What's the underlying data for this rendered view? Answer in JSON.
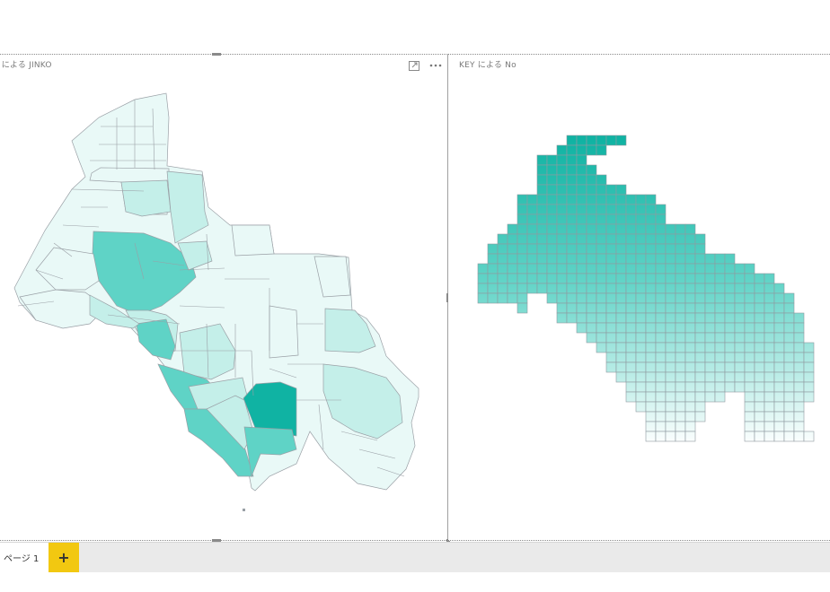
{
  "visuals": {
    "left": {
      "title": "' による JINKO",
      "focus_mode_icon": "focus-mode-icon",
      "more_options_icon": "more-options-icon"
    },
    "right": {
      "title": "KEY による No"
    }
  },
  "colors": {
    "fill_dark": "#10b3a3",
    "fill_mid": "#5fd3c6",
    "fill_light": "#c4efe9",
    "fill_pale": "#e9f9f7",
    "stroke": "#9aa0a6",
    "tab_accent": "#f2c811"
  },
  "page_tabs": [
    {
      "label": "ページ 1",
      "active": true
    }
  ],
  "add_page_label": "+"
}
